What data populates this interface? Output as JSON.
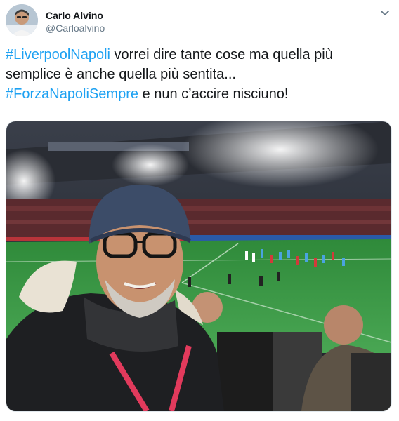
{
  "tweet": {
    "author": {
      "display_name": "Carlo Alvino",
      "handle": "@Carloalvino",
      "avatar_icon": "profile-photo"
    },
    "menu_icon": "chevron-down-icon",
    "text": {
      "line1_hashtag": "#LiverpoolNapoli",
      "line1_text": " vorrei dire tante cose ma quella più",
      "line2_text": "semplice è anche quella più sentita...",
      "line3_hashtag": "#ForzaNapoliSempre",
      "line3_text": " e nun c’accire nisciuno!"
    },
    "media": {
      "type": "photo",
      "icon": "stadium-selfie-photo"
    }
  },
  "colors": {
    "hashtag": "#1da1f2",
    "name": "#14171a",
    "handle": "#657786"
  }
}
